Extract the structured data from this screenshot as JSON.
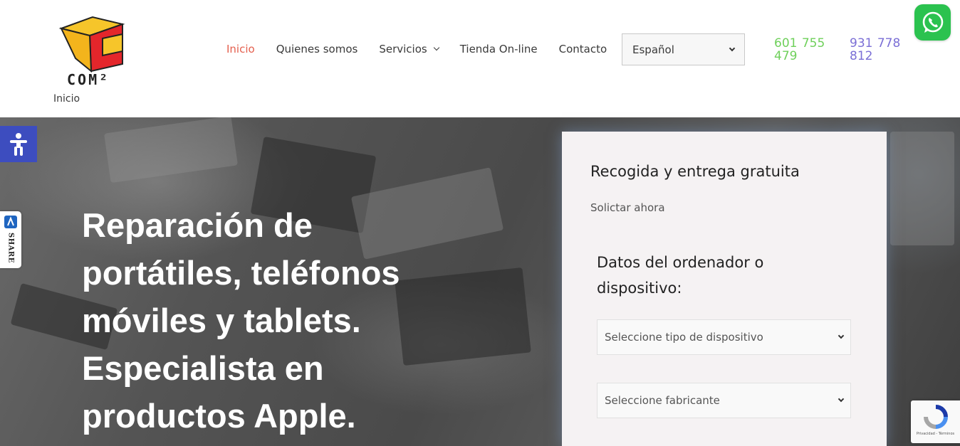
{
  "header": {
    "logo_text": "COM²",
    "breadcrumb": "Inicio",
    "nav": [
      {
        "label": "Inicio",
        "active": true
      },
      {
        "label": "Quienes somos"
      },
      {
        "label": "Servicios",
        "has_dropdown": true
      },
      {
        "label": "Tienda On-line"
      },
      {
        "label": "Contacto"
      }
    ],
    "language_select": {
      "value": "Español"
    },
    "phones": [
      "601 755 479",
      "931 778 812"
    ],
    "colors": {
      "active_nav": "#e45f4d",
      "phone_1": "#6fd05b",
      "phone_2": "#7b6fd6",
      "whatsapp": "#2bc24f"
    }
  },
  "hero": {
    "title": "Reparación de portátiles, teléfonos móviles y tablets. Especialista en productos Apple."
  },
  "side_widgets": {
    "accessibility_icon": "accessibility-icon",
    "share_label": "SHARE"
  },
  "form": {
    "title": "Recogida y entrega gratuita",
    "subtitle": "Solictar ahora",
    "section_title": "Datos del ordenador o dispositivo:",
    "device_type_select": {
      "value": "Seleccione tipo de dispositivo"
    },
    "manufacturer_select": {
      "value": "Seleccione fabricante"
    }
  },
  "recaptcha": {
    "links": "Privacidad - Términos"
  }
}
